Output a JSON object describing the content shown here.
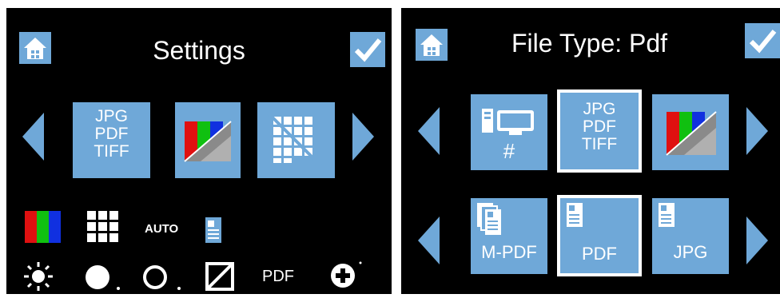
{
  "left_panel": {
    "title": "Settings",
    "tile_format_lines": [
      "JPG",
      "PDF",
      "TIFF"
    ],
    "status_auto": "AUTO",
    "status_format": "PDF"
  },
  "right_panel": {
    "title": "File Type: Pdf",
    "tile_format_lines": [
      "JPG",
      "PDF",
      "TIFF"
    ],
    "tile_counter_label": "#",
    "tile_mpdf_label": "M-PDF",
    "tile_pdf_label": "PDF",
    "tile_jpg_label": "JPG"
  },
  "colors": {
    "accent": "#6fa8d8",
    "background": "#000000",
    "selected_border": "#ffffff"
  },
  "icons": [
    "home-icon",
    "check-icon",
    "color-mode-icon",
    "resolution-grid-icon",
    "brightness-icon",
    "contrast-icon",
    "plus-icon"
  ]
}
